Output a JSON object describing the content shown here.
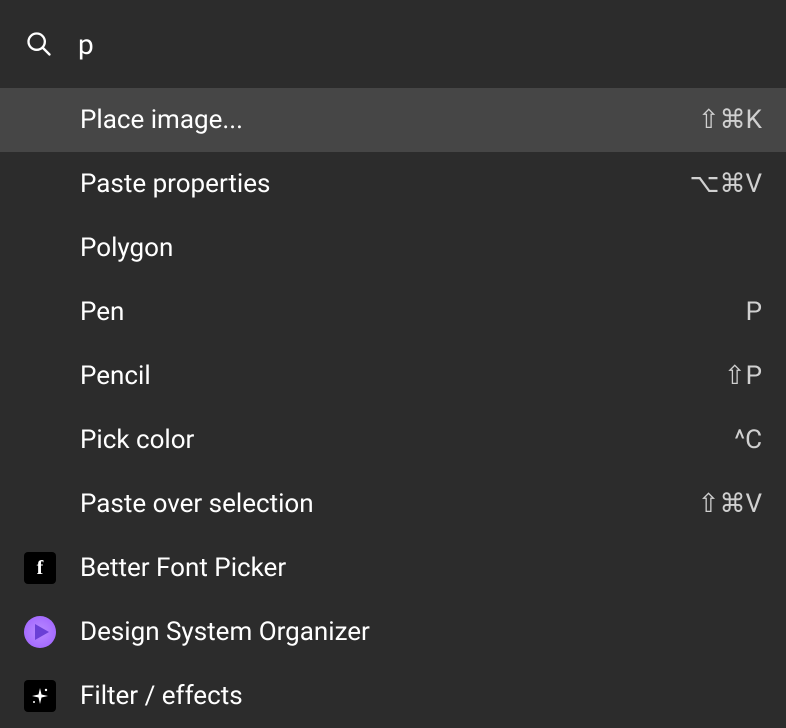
{
  "search": {
    "value": "p",
    "placeholder": ""
  },
  "results": [
    {
      "id": "place-image",
      "label": "Place image...",
      "shortcut": "⇧⌘K",
      "icon": null,
      "highlighted": true
    },
    {
      "id": "paste-properties",
      "label": "Paste properties",
      "shortcut": "⌥⌘V",
      "icon": null,
      "highlighted": false
    },
    {
      "id": "polygon",
      "label": "Polygon",
      "shortcut": "",
      "icon": null,
      "highlighted": false
    },
    {
      "id": "pen",
      "label": "Pen",
      "shortcut": "P",
      "icon": null,
      "highlighted": false
    },
    {
      "id": "pencil",
      "label": "Pencil",
      "shortcut": "⇧P",
      "icon": null,
      "highlighted": false
    },
    {
      "id": "pick-color",
      "label": "Pick color",
      "shortcut": "^C",
      "icon": null,
      "highlighted": false
    },
    {
      "id": "paste-over-selection",
      "label": "Paste over selection",
      "shortcut": "⇧⌘V",
      "icon": null,
      "highlighted": false
    },
    {
      "id": "better-font-picker",
      "label": "Better Font Picker",
      "shortcut": "",
      "icon": "font-icon",
      "highlighted": false
    },
    {
      "id": "design-system-organizer",
      "label": "Design System Organizer",
      "shortcut": "",
      "icon": "play-icon",
      "highlighted": false
    },
    {
      "id": "filter-effects",
      "label": "Filter / effects",
      "shortcut": "",
      "icon": "sparkle-icon",
      "highlighted": false
    }
  ]
}
